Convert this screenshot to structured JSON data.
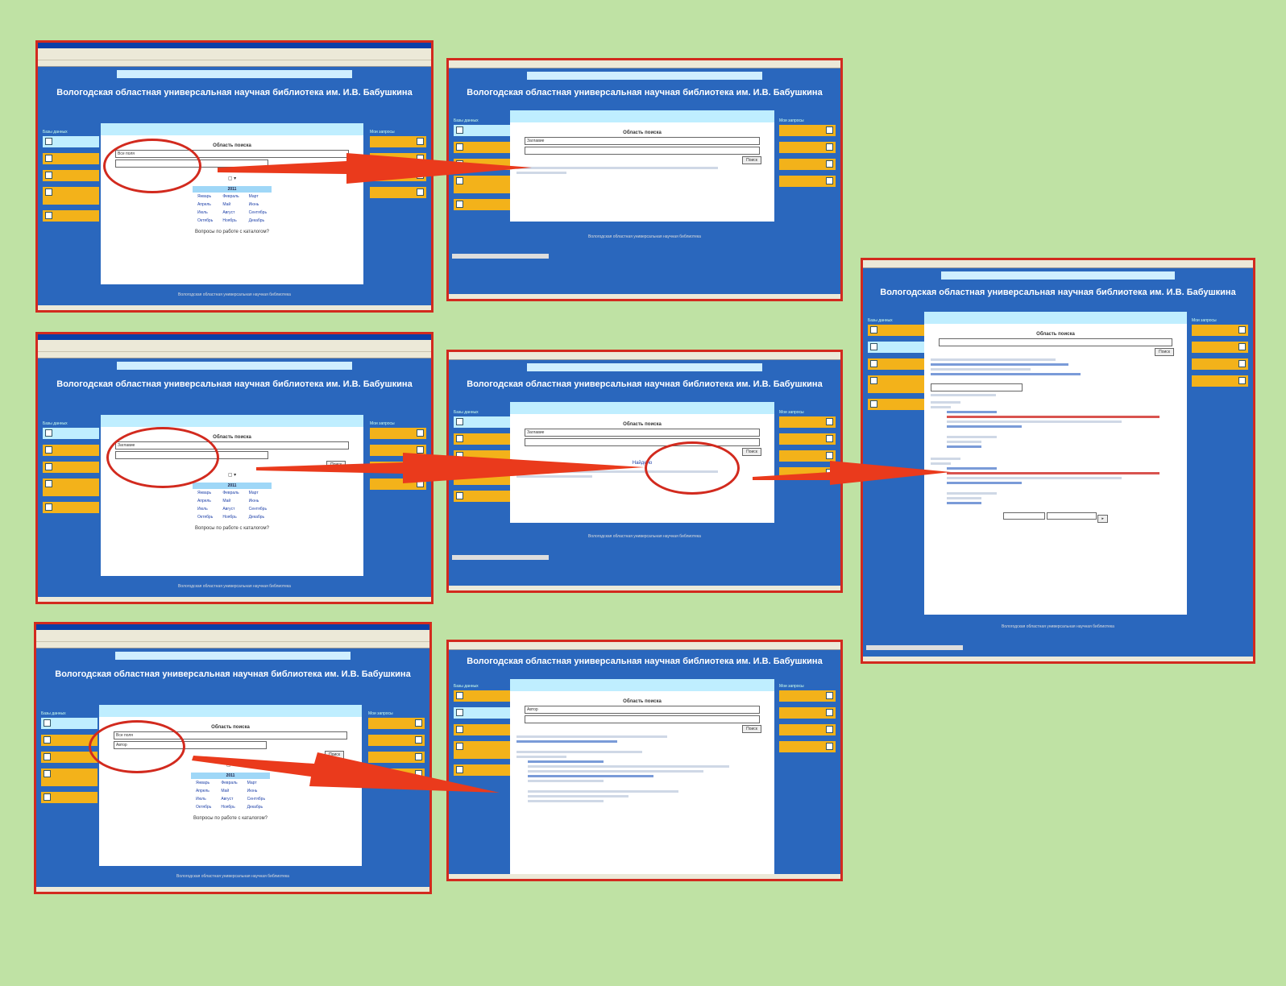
{
  "site_title": "Вологодская областная универсальная научная библиотека им. И.В. Бабушкина",
  "search_label": "Область поиска",
  "search_button": "Поиск",
  "years_header": "2011",
  "years": [
    "Январь",
    "Февраль",
    "Март",
    "Апрель",
    "Май",
    "Июнь",
    "Июль",
    "Август",
    "Сентябрь",
    "Октябрь",
    "Ноябрь",
    "Декабрь"
  ],
  "question": "Вопросы по работе с каталогом?",
  "left_tabs_head": "Базы данных",
  "right_tabs_head": "Мои запросы",
  "footer": "Вологодская областная универсальная научная библиотека",
  "result_link": "Найдено",
  "search_field_values": [
    "Все поля",
    "Заглавие",
    "Автор"
  ],
  "colors": {
    "background": "#bfe2a4",
    "frame": "#d22a1e",
    "page": "#2a67bd",
    "tab": "#f3b21a",
    "panel_head": "#bfeeff"
  }
}
